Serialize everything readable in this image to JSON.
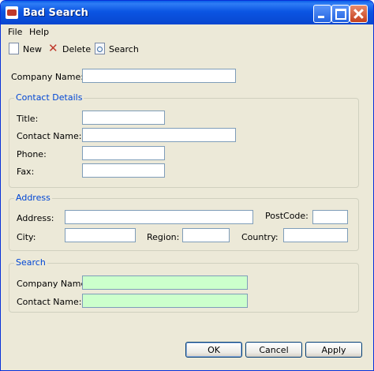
{
  "window": {
    "title": "Bad Search"
  },
  "menu": {
    "file": "File",
    "help": "Help"
  },
  "toolbar": {
    "new": "New",
    "delete": "Delete",
    "search": "Search"
  },
  "company": {
    "label": "Company Name:",
    "value": ""
  },
  "contact": {
    "legend": "Contact Details",
    "title_label": "Title:",
    "name_label": "Contact Name:",
    "phone_label": "Phone:",
    "fax_label": "Fax:"
  },
  "address": {
    "legend": "Address",
    "address_label": "Address:",
    "postcode_label": "PostCode:",
    "city_label": "City:",
    "region_label": "Region:",
    "country_label": "Country:"
  },
  "search": {
    "legend": "Search",
    "company_label": "Company Name:",
    "contact_label": "Contact Name:",
    "highlight_color": "#ccffcc"
  },
  "buttons": {
    "ok": "OK",
    "cancel": "Cancel",
    "apply": "Apply"
  }
}
